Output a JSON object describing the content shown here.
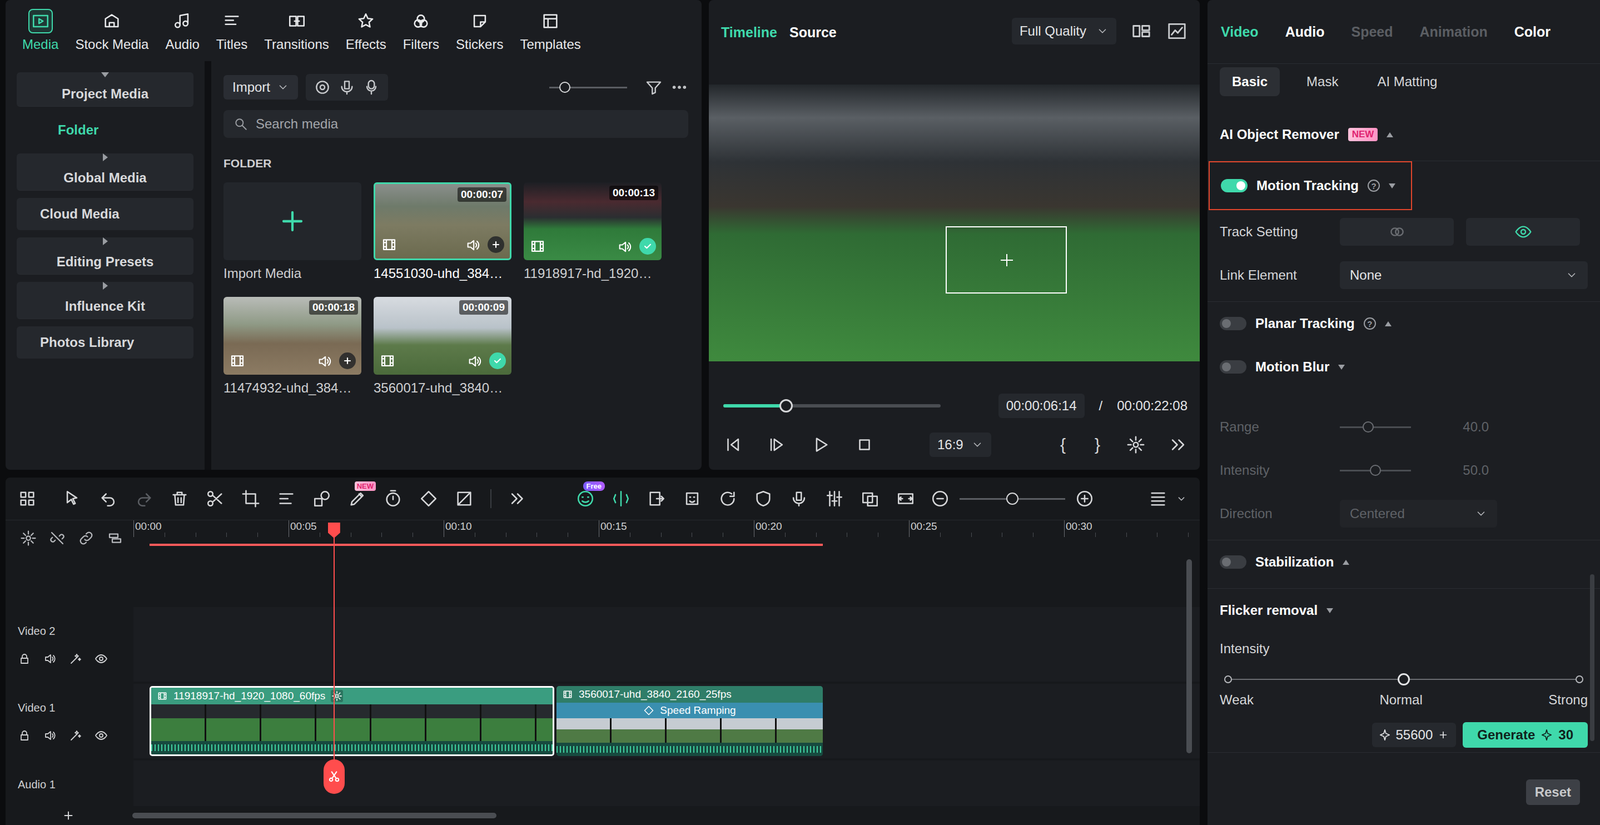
{
  "media_panel": {
    "tabs": [
      {
        "label": "Media",
        "selected": true
      },
      {
        "label": "Stock Media",
        "selected": false
      },
      {
        "label": "Audio",
        "selected": false
      },
      {
        "label": "Titles",
        "selected": false
      },
      {
        "label": "Transitions",
        "selected": false
      },
      {
        "label": "Effects",
        "selected": false
      },
      {
        "label": "Filters",
        "selected": false
      },
      {
        "label": "Stickers",
        "selected": false
      },
      {
        "label": "Templates",
        "selected": false
      }
    ],
    "sidebar": [
      {
        "label": "Project Media",
        "kind": "group",
        "expanded": true,
        "selected": false
      },
      {
        "label": "Folder",
        "kind": "child",
        "expanded": false,
        "selected": true
      },
      {
        "label": "Global Media",
        "kind": "group",
        "expanded": false,
        "selected": false
      },
      {
        "label": "Cloud Media",
        "kind": "item",
        "expanded": false,
        "selected": false
      },
      {
        "label": "Editing Presets",
        "kind": "group",
        "expanded": false,
        "selected": false
      },
      {
        "label": "Influence Kit",
        "kind": "group",
        "expanded": false,
        "selected": false
      },
      {
        "label": "Photos Library",
        "kind": "item",
        "expanded": false,
        "selected": false
      }
    ],
    "import_button": "Import",
    "thumb_size": {
      "level": 0.2
    },
    "search": {
      "placeholder": "Search media"
    },
    "section_label": "FOLDER",
    "import_card": {
      "label": "Import Media"
    },
    "items": [
      {
        "name": "14551030-uhd_384…",
        "duration": "00:00:07",
        "selected": true,
        "in_timeline": false
      },
      {
        "name": "11918917-hd_1920…",
        "duration": "00:00:13",
        "selected": false,
        "in_timeline": true
      },
      {
        "name": "11474932-uhd_384…",
        "duration": "00:00:18",
        "selected": false,
        "in_timeline": false
      },
      {
        "name": "3560017-uhd_3840…",
        "duration": "00:00:09",
        "selected": false,
        "in_timeline": true
      }
    ]
  },
  "preview": {
    "tabs": [
      {
        "label": "Timeline",
        "selected": true
      },
      {
        "label": "Source",
        "selected": false
      }
    ],
    "quality": "Full Quality",
    "tracking_box": true,
    "progress": {
      "level": 0.29
    },
    "current_time": "00:00:06:14",
    "time_separator": "/",
    "total_time": "00:00:22:08",
    "aspect_ratio": "16:9",
    "mark_in": "{",
    "mark_out": "}"
  },
  "timeline": {
    "badges": {
      "new": "NEW",
      "free": "Free"
    },
    "history": {
      "undo_enabled": true,
      "redo_enabled": false
    },
    "zoom": {
      "level": 0.5
    },
    "ruler": [
      "00:00",
      "00:05",
      "00:10",
      "00:15",
      "00:20",
      "00:25",
      "00:30"
    ],
    "tracks": [
      {
        "name": "Video 2",
        "clips": []
      },
      {
        "name": "Video 1",
        "clips": [
          {
            "name": "11918917-hd_1920_1080_60fps",
            "selected": true,
            "tracked": true
          },
          {
            "name": "3560017-uhd_3840_2160_25fps",
            "selected": false,
            "tracked": false,
            "effect": "Speed Ramping"
          }
        ]
      },
      {
        "name": "Audio 1",
        "clips": []
      }
    ]
  },
  "properties": {
    "tabs": [
      {
        "label": "Video",
        "selected": true,
        "disabled": false
      },
      {
        "label": "Audio",
        "selected": false,
        "disabled": false
      },
      {
        "label": "Speed",
        "selected": false,
        "disabled": true
      },
      {
        "label": "Animation",
        "selected": false,
        "disabled": true
      },
      {
        "label": "Color",
        "selected": false,
        "disabled": false
      }
    ],
    "subtabs": [
      {
        "label": "Basic",
        "selected": true
      },
      {
        "label": "Mask",
        "selected": false
      },
      {
        "label": "AI Matting",
        "selected": false
      }
    ],
    "groups": [
      [
        {
          "kind": "header",
          "label": "AI Object Remover",
          "badge": "NEW",
          "expanded": false
        }
      ],
      [
        {
          "kind": "toggle",
          "label": "Motion Tracking",
          "on": true,
          "help": "?",
          "expanded": true,
          "highlighted": true
        },
        {
          "kind": "buttons",
          "label": "Track Setting",
          "options": [
            {
              "selected": false
            },
            {
              "selected": true
            }
          ]
        },
        {
          "kind": "select",
          "label": "Link Element",
          "value": "None",
          "disabled": false
        }
      ],
      [
        {
          "kind": "toggle",
          "label": "Planar Tracking",
          "on": false,
          "help": "?",
          "expanded": false,
          "highlighted": false
        },
        {
          "kind": "toggle",
          "label": "Motion Blur",
          "on": false,
          "expanded": true,
          "highlighted": false
        },
        {
          "kind": "slider",
          "label": "Range",
          "level": 0.4,
          "value": "40.0",
          "disabled": true
        },
        {
          "kind": "slider",
          "label": "Intensity",
          "level": 0.5,
          "value": "50.0",
          "disabled": true
        },
        {
          "kind": "select",
          "label": "Direction",
          "value": "Centered",
          "disabled": true
        }
      ],
      [
        {
          "kind": "toggle",
          "label": "Stabilization",
          "on": false,
          "expanded": false,
          "highlighted": false
        }
      ],
      [
        {
          "kind": "header",
          "label": "Flicker removal",
          "expanded": true
        },
        {
          "kind": "label",
          "label": "Intensity"
        },
        {
          "kind": "steps",
          "stops": [
            {
              "label": "Weak",
              "selected": false
            },
            {
              "label": "Normal",
              "selected": true
            },
            {
              "label": "Strong",
              "selected": false
            }
          ]
        },
        {
          "kind": "generate",
          "credits": "55600",
          "button": "Generate",
          "cost": "30"
        }
      ]
    ],
    "reset": "Reset"
  }
}
